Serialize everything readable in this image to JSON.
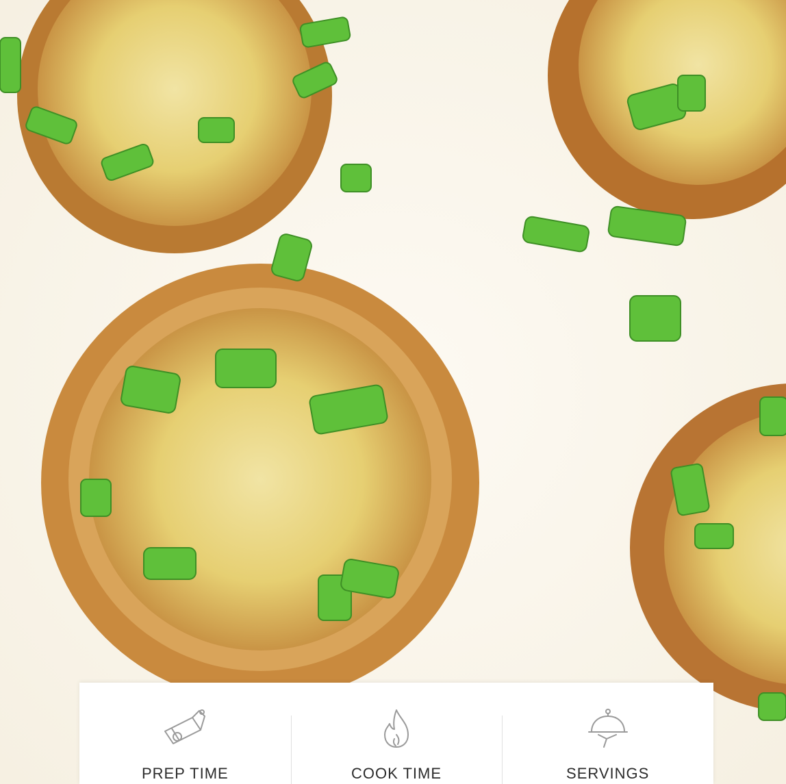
{
  "hero": {
    "image_icon": "mini-quiche-photo"
  },
  "recipe_info": {
    "prep": {
      "label": "PREP TIME",
      "icon": "cutting-board-icon"
    },
    "cook": {
      "label": "COOK TIME",
      "icon": "flame-icon"
    },
    "servings": {
      "label": "SERVINGS",
      "icon": "cloche-icon"
    }
  },
  "colors": {
    "background": "#fbf8f1",
    "card": "#ffffff",
    "icon_stroke": "#9a9a9a",
    "label_text": "#2b2b2b",
    "pastry": "#c98a3e",
    "filling": "#e8d27a",
    "scallion": "#5fc03a"
  }
}
